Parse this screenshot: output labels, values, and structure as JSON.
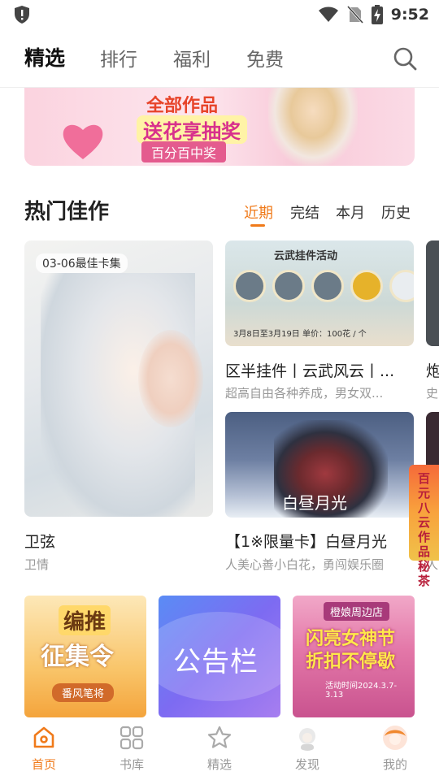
{
  "status_bar": {
    "time": "9:52"
  },
  "top_tabs": [
    "精选",
    "排行",
    "福利",
    "免费"
  ],
  "banner": {
    "title": "全部作品",
    "subtitle": "送花享抽奖",
    "chip": "百分百中奖"
  },
  "section": {
    "title": "热门佳作",
    "filters": [
      "近期",
      "完结",
      "本月",
      "历史"
    ]
  },
  "cards": {
    "big": {
      "badge": "03-06最佳卡集",
      "title": "卫弦",
      "subtitle": "卫情"
    },
    "small1": {
      "art_title": "云武挂件活动",
      "art_foot": "3月8日至3月19日 单价：100花 / 个",
      "title": "区半挂件丨云武风云丨...",
      "subtitle": "超高自由各种养成，男女双..."
    },
    "small2": {
      "art_text": "白昼月光",
      "title": "【1※限量卡】白昼月光",
      "subtitle": "人美心善小白花，勇闯娱乐圈"
    },
    "peek1": {
      "title": "炮",
      "subtitle": "史"
    },
    "peek2": {
      "subtitle": "人"
    }
  },
  "floating_badge": "百元八云作品秘茶",
  "promos": {
    "p1": {
      "t1": "编推",
      "t2": "征集令",
      "t3": "番风笔将"
    },
    "p2": {
      "text": "公告栏"
    },
    "p3": {
      "t1": "橙娘周边店",
      "t2": "闪亮女神节\n折扣不停歇",
      "t3": "活动时间2024.3.7-3.13"
    }
  },
  "bottom_nav": [
    "首页",
    "书库",
    "精选",
    "发现",
    "我的"
  ],
  "colors": {
    "accent": "#f07a1a"
  }
}
